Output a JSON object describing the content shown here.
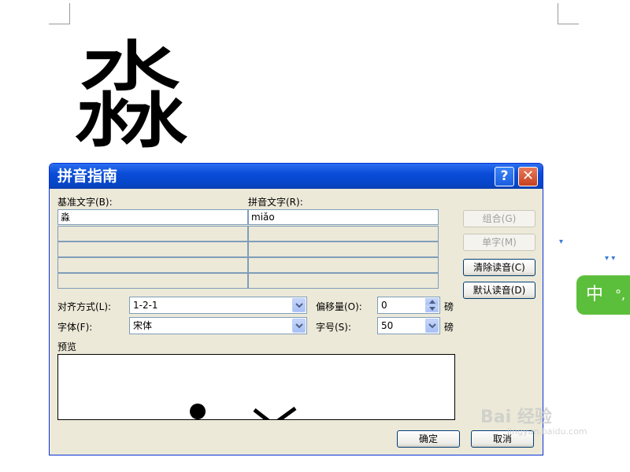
{
  "document": {
    "big_char": "淼"
  },
  "ime": {
    "label": "中",
    "mode_glyph": "°,"
  },
  "dialog": {
    "title": "拼音指南",
    "help_button": "?",
    "close_button": "✕",
    "base_text_label": "基准文字(B):",
    "ruby_text_label": "拼音文字(R):",
    "rows": [
      {
        "base": "淼",
        "ruby": "miǎo"
      },
      {
        "base": "",
        "ruby": ""
      },
      {
        "base": "",
        "ruby": ""
      },
      {
        "base": "",
        "ruby": ""
      },
      {
        "base": "",
        "ruby": ""
      }
    ],
    "buttons": {
      "group": "组合(G)",
      "single": "单字(M)",
      "clear": "清除读音(C)",
      "default": "默认读音(D)",
      "ok": "确定",
      "cancel": "取消"
    },
    "alignment_label": "对齐方式(L):",
    "alignment_value": "1-2-1",
    "offset_label": "偏移量(O):",
    "offset_value": "0",
    "offset_unit": "磅",
    "font_label": "字体(F):",
    "font_value": "宋体",
    "size_label": "字号(S):",
    "size_value": "50",
    "size_unit": "磅",
    "preview_label": "预览"
  },
  "watermark": {
    "text": "Bai 经验",
    "url": "jingyan.baidu.com"
  },
  "colors": {
    "title_bar": "#0a4cd8",
    "dialog_bg": "#ece9d8",
    "ime_green": "#5cbf3b"
  }
}
